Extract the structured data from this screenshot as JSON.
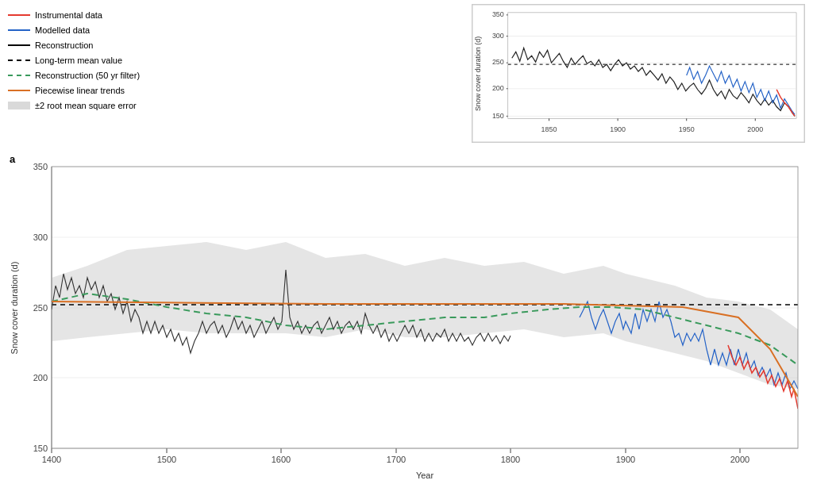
{
  "legend": {
    "items": [
      {
        "id": "instrumental",
        "label": "Instrumental data",
        "type": "solid",
        "color": "#e53a2f"
      },
      {
        "id": "modelled",
        "label": "Modelled data",
        "type": "solid",
        "color": "#2563c7"
      },
      {
        "id": "reconstruction",
        "label": "Reconstruction",
        "type": "solid",
        "color": "#000000"
      },
      {
        "id": "longterm",
        "label": "Long-term mean value",
        "type": "dashed",
        "color": "#000000"
      },
      {
        "id": "recon50",
        "label": "Reconstruction (50 yr filter)",
        "type": "dashed",
        "color": "#3a9a5c"
      },
      {
        "id": "piecewise",
        "label": "Piecewise linear trends",
        "type": "solid",
        "color": "#d97024"
      },
      {
        "id": "rmse",
        "label": "±2 root mean square error",
        "type": "rect",
        "color": "rgba(180,180,180,0.5)"
      }
    ]
  },
  "inset_chart": {
    "y_axis": {
      "label": "Snow cover duration (d)",
      "ticks": [
        150,
        200,
        250,
        300,
        350
      ],
      "min": 150,
      "max": 350
    },
    "x_axis": {
      "ticks": [
        1850,
        1900,
        1950,
        2000
      ]
    }
  },
  "main_chart": {
    "label": "a",
    "y_axis": {
      "label": "Snow cover duration (d)",
      "ticks": [
        150,
        200,
        250,
        300,
        350
      ],
      "min": 150,
      "max": 350
    },
    "x_axis": {
      "ticks": [
        1400,
        1500,
        1600,
        1700,
        1800,
        1900,
        2000
      ],
      "label": "Year"
    }
  }
}
